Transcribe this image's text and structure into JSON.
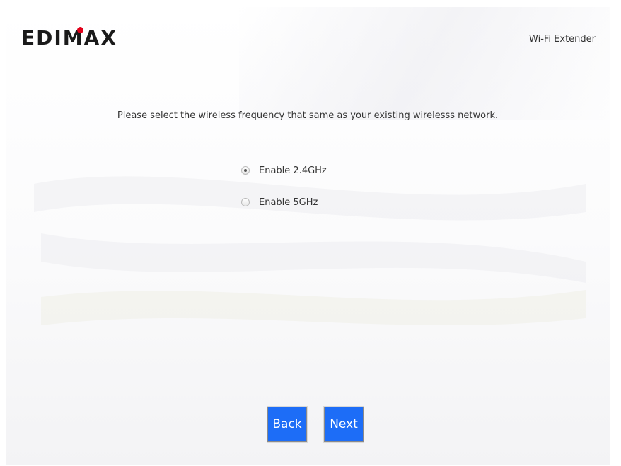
{
  "header": {
    "brand": "EDIMAX",
    "product": "Wi-Fi Extender"
  },
  "main": {
    "instruction": "Please select the wireless frequency that same as your existing wirelesss network.",
    "options": [
      {
        "label": "Enable 2.4GHz",
        "checked": true
      },
      {
        "label": "Enable 5GHz",
        "checked": false
      }
    ]
  },
  "footer": {
    "back_label": "Back",
    "next_label": "Next"
  },
  "colors": {
    "button": "#1d6df7",
    "logo_dot": "#e2001a",
    "logo_text": "#1a1a1a"
  }
}
